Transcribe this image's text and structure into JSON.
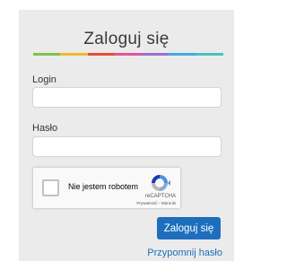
{
  "login_form": {
    "title": "Zaloguj się",
    "login_label": "Login",
    "login_value": "",
    "password_label": "Hasło",
    "password_value": "",
    "submit_label": "Zaloguj się",
    "forgot_link": "Przypomnij hasło"
  },
  "recaptcha": {
    "checkbox_label": "Nie jestem robotem",
    "brand": "reCAPTCHA",
    "links": "Prywatność - Warunki",
    "checked": false
  },
  "colors": {
    "accent": "#1d6fbd",
    "panel_background": "#ebebeb",
    "rainbow": [
      "#7dc24b",
      "#f2b92a",
      "#e44d3a",
      "#e0559d",
      "#9a6fd1",
      "#46a8e3",
      "#44c4c0"
    ]
  }
}
